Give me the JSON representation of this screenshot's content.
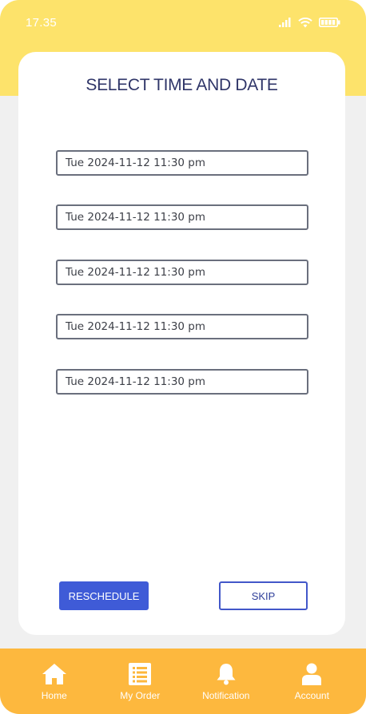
{
  "status_bar": {
    "time": "17.35",
    "icons": [
      "signal-icon",
      "wifi-icon",
      "battery-icon"
    ]
  },
  "colors": {
    "header_yellow": "#fde36b",
    "nav_orange": "#fdb83e",
    "primary_blue": "#3f5bd7",
    "title_navy": "#2f3568"
  },
  "page": {
    "title": "SELECT TIME AND DATE"
  },
  "date_slots": [
    "Tue 2024-11-12 11:30 pm",
    "Tue 2024-11-12 11:30 pm",
    "Tue 2024-11-12 11:30 pm",
    "Tue 2024-11-12 11:30 pm",
    "Tue 2024-11-12 11:30 pm"
  ],
  "actions": {
    "reschedule_label": "RESCHEDULE",
    "skip_label": "SKIP"
  },
  "bottom_nav": {
    "items": [
      {
        "label": "Home",
        "icon": "home-icon"
      },
      {
        "label": "My Order",
        "icon": "list-icon"
      },
      {
        "label": "Notification",
        "icon": "bell-icon"
      },
      {
        "label": "Account",
        "icon": "user-icon"
      }
    ]
  }
}
